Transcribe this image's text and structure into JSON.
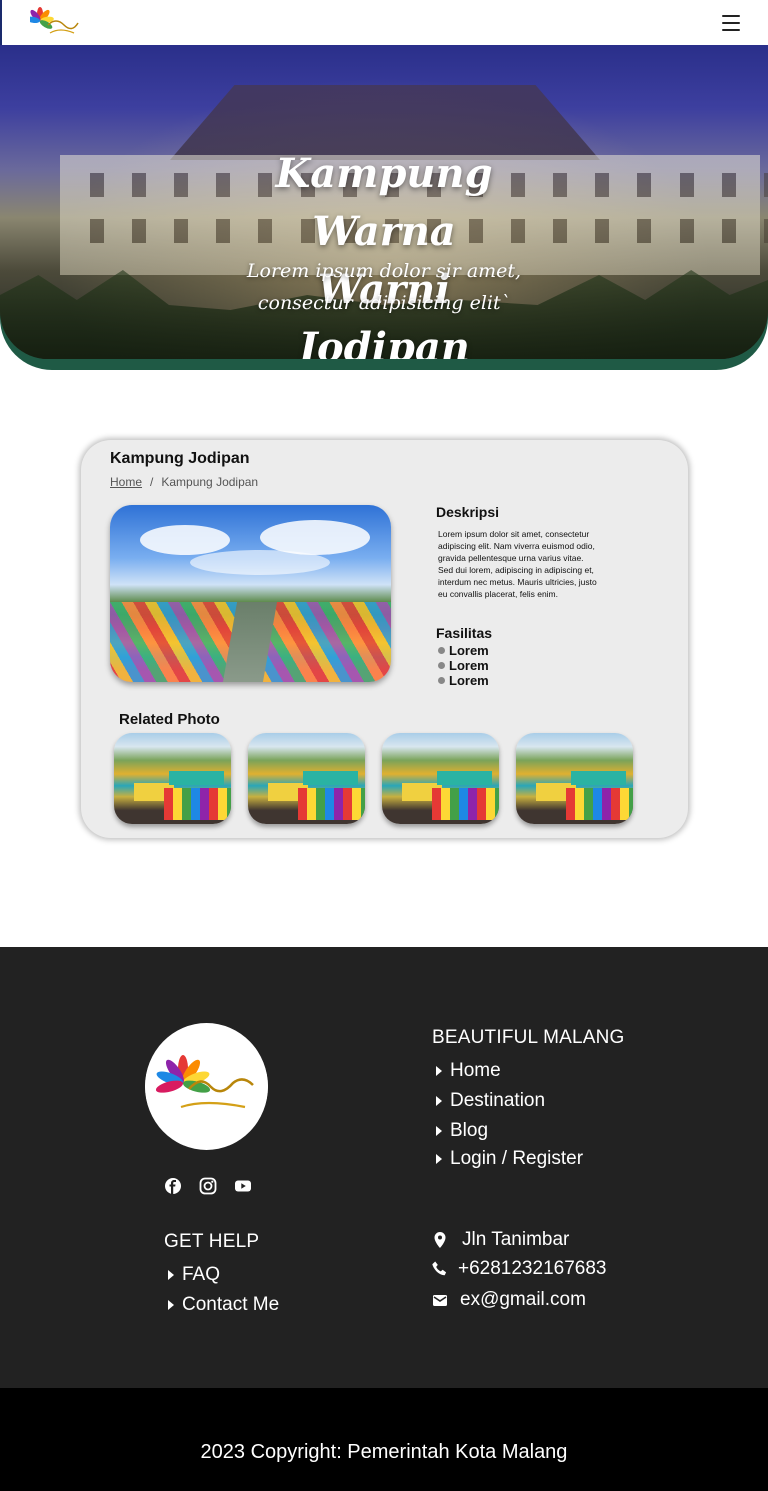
{
  "brand": {
    "logo_alt": "Beautiful Malang",
    "colors": {
      "accent": "#1f5a45",
      "footer_bg": "#222222",
      "copyright_bg": "#000000"
    }
  },
  "navbar": {
    "menu_icon": "hamburger-icon"
  },
  "hero": {
    "title": "Kampung Warna Warni Jodipan",
    "subtitle": "Lorem ipsum dolor sir amet, consectur adipisicing elit`"
  },
  "detail": {
    "title": "Kampung Jodipan",
    "breadcrumb": {
      "home": "Home",
      "separator": "/",
      "current": "Kampung Jodipan"
    },
    "description_title": "Deskripsi",
    "description": "Lorem ipsum dolor sit amet, consectetur adipiscing elit. Nam viverra euismod odio, gravida pellentesque urna varius vitae. Sed dui lorem, adipiscing in adipiscing et, interdum nec metus. Mauris ultricies, justo eu convallis placerat, felis enim.",
    "facilities_title": "Fasilitas",
    "facilities": [
      "Lorem",
      "Lorem",
      "Lorem"
    ],
    "related_title": "Related Photo",
    "related_count": 4
  },
  "footer": {
    "site_heading": "BEAUTIFUL MALANG",
    "site_links": [
      "Home",
      "Destination",
      "Blog",
      "Login / Register"
    ],
    "help_heading": "GET HELP",
    "help_links": [
      "FAQ",
      "Contact Me"
    ],
    "social_icons": [
      "facebook-icon",
      "instagram-icon",
      "youtube-icon"
    ],
    "contact": {
      "address": "Jln Tanimbar",
      "phone": "+6281232167683",
      "email": "ex@gmail.com"
    }
  },
  "copyright": "2023 Copyright: Pemerintah Kota Malang"
}
